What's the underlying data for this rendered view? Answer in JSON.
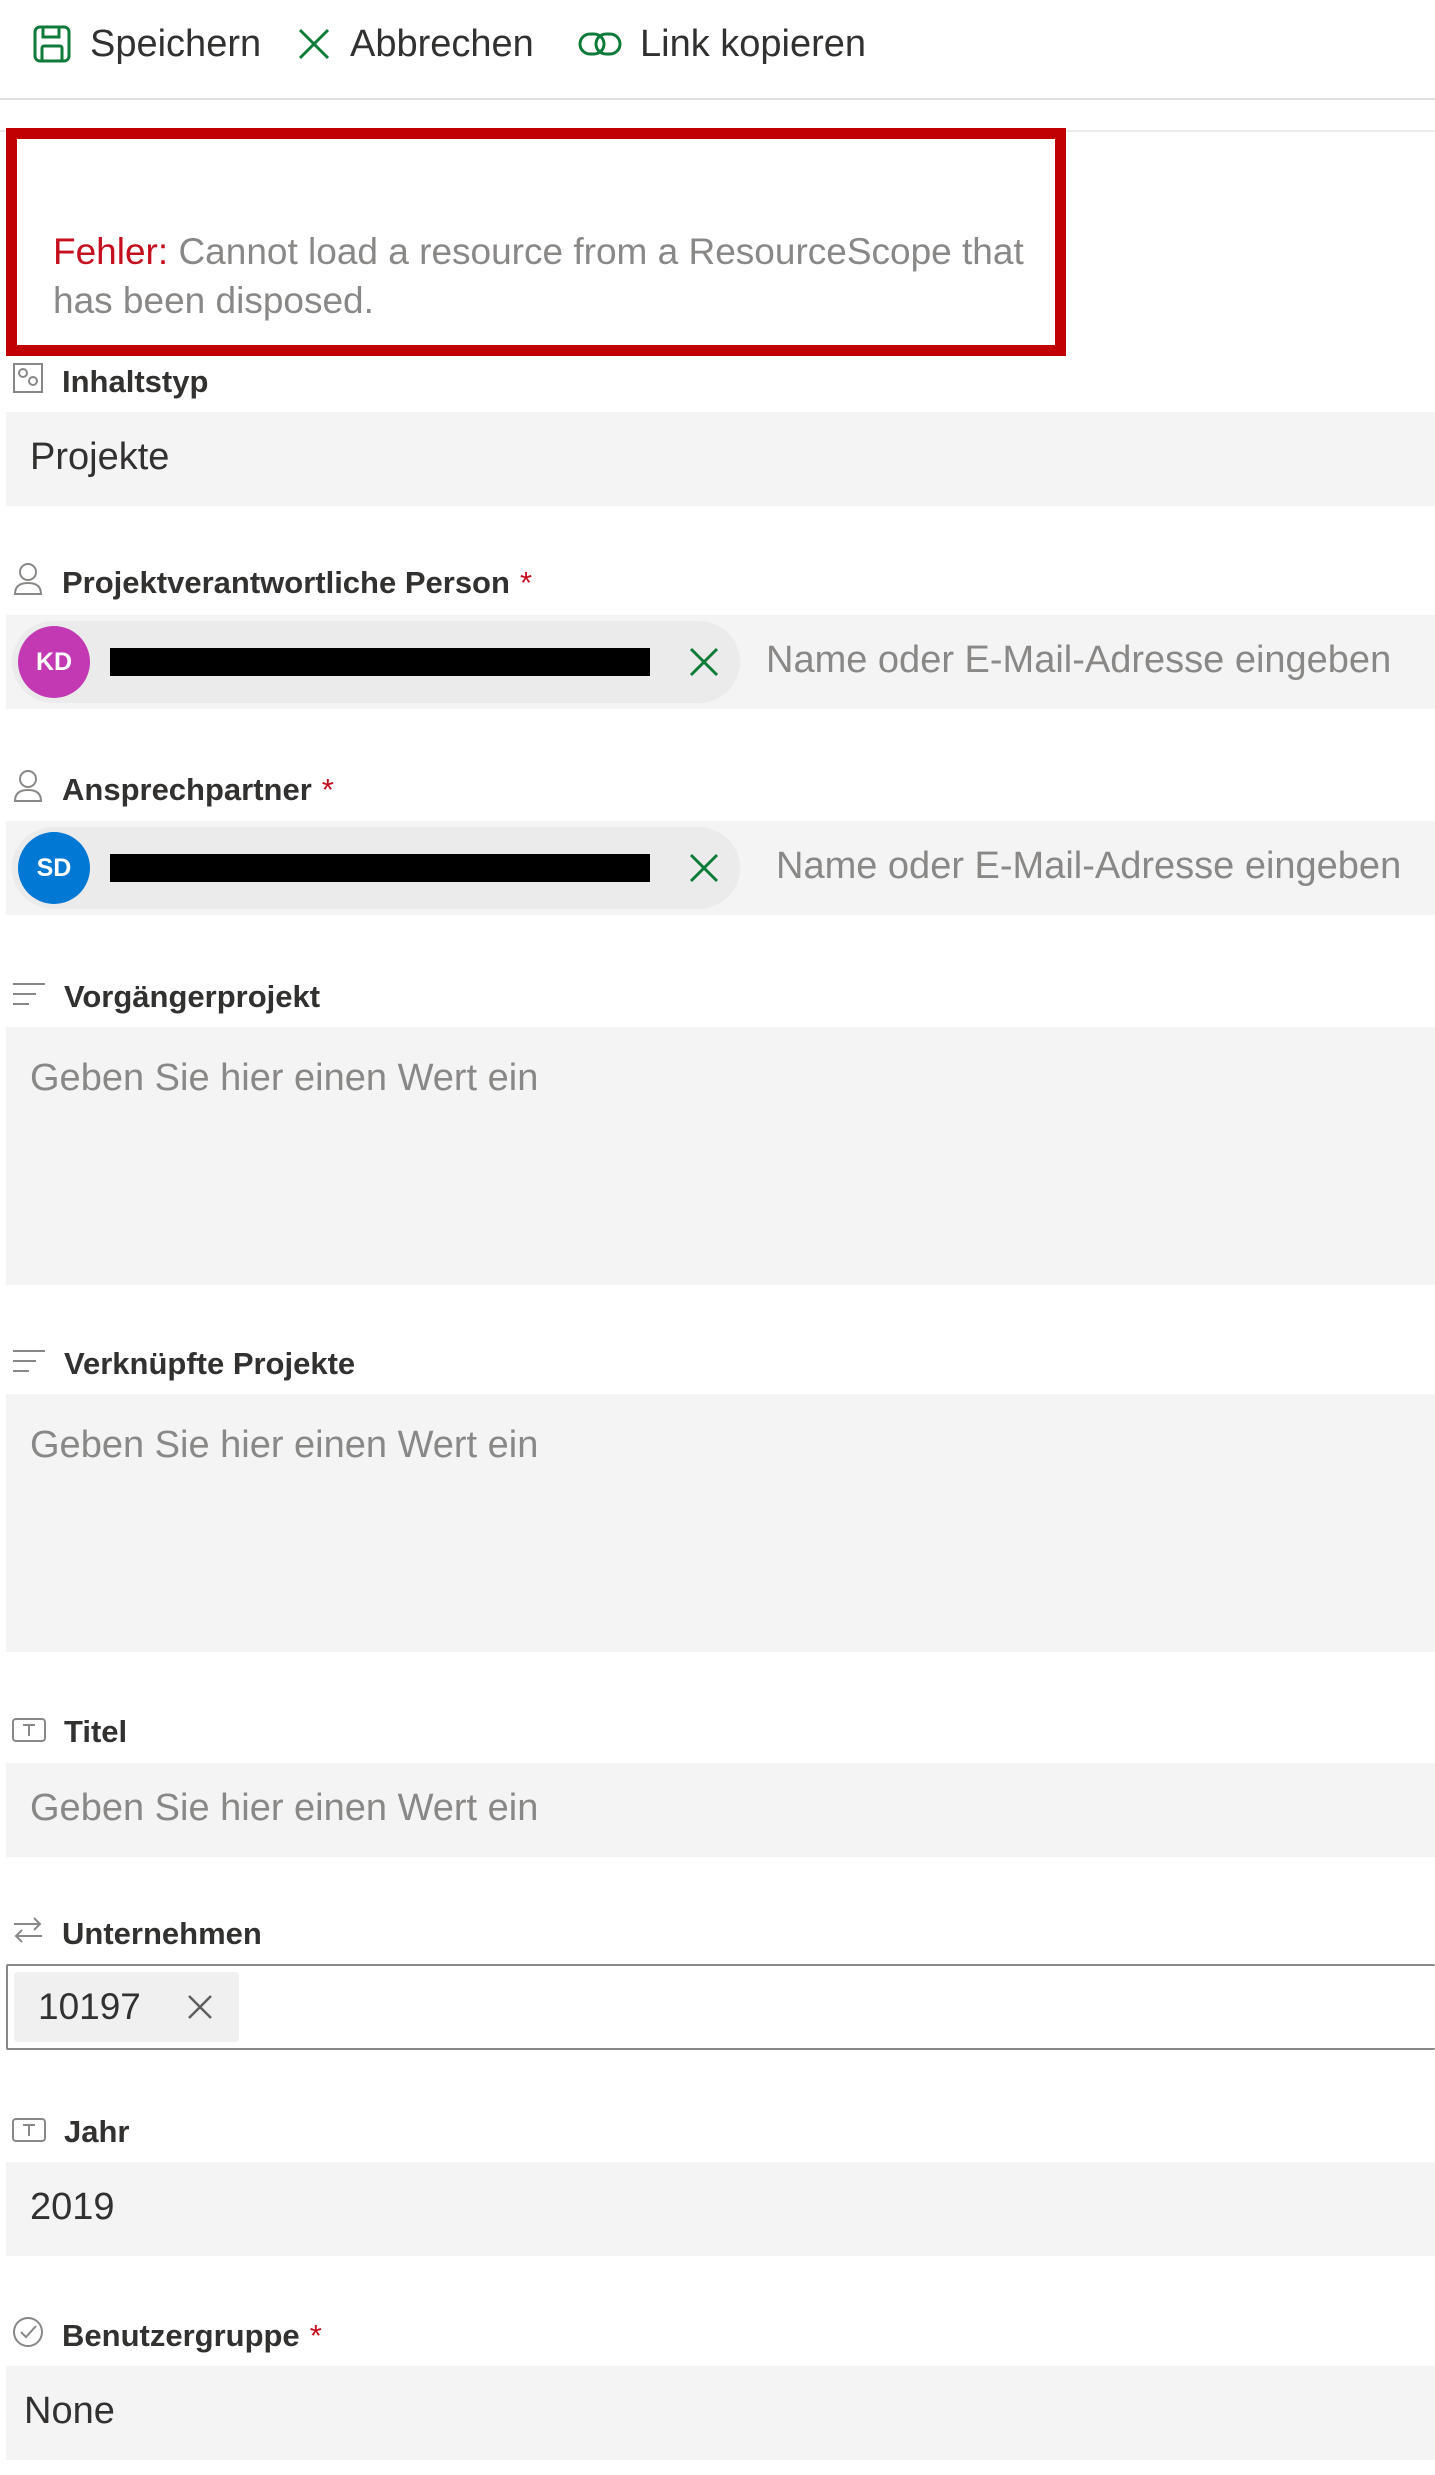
{
  "toolbar": {
    "save_label": "Speichern",
    "cancel_label": "Abbrechen",
    "copy_link_label": "Link kopieren"
  },
  "error": {
    "prefix": "Fehler:",
    "message": "Cannot load a resource from a ResourceScope that has been disposed."
  },
  "fields": {
    "content_type": {
      "label": "Inhaltstyp",
      "value": "Projekte"
    },
    "project_owner": {
      "label": "Projektverantwortliche Person",
      "required_mark": "*",
      "persona_initials": "KD",
      "placeholder": "Name oder E-Mail-Adresse eingeben"
    },
    "contact": {
      "label": "Ansprechpartner",
      "required_mark": "*",
      "persona_initials": "SD",
      "placeholder": "Name oder E-Mail-Adresse eingeben"
    },
    "predecessor_project": {
      "label": "Vorgängerprojekt",
      "placeholder": "Geben Sie hier einen Wert ein"
    },
    "linked_projects": {
      "label": "Verknüpfte Projekte",
      "placeholder": "Geben Sie hier einen Wert ein"
    },
    "title": {
      "label": "Titel",
      "placeholder": "Geben Sie hier einen Wert ein"
    },
    "company": {
      "label": "Unternehmen",
      "tag_value": "10197"
    },
    "year": {
      "label": "Jahr",
      "value": "2019"
    },
    "user_group": {
      "label": "Benutzergruppe",
      "required_mark": "*",
      "value": "None"
    }
  },
  "colors": {
    "save_icon": "#0f7b3b",
    "cancel_icon": "#0f7b3b",
    "link_icon": "#0f7b3b",
    "error_border": "#c00000",
    "error_label": "#c50f1f",
    "required": "#c50f1f",
    "avatar_kd": "#c239b3",
    "avatar_sd": "#0078d4"
  },
  "icons": {
    "save": "save-icon",
    "cancel": "close-icon",
    "link": "link-icon",
    "content_type": "content-type-icon",
    "person": "person-icon",
    "multiline": "multiline-text-icon",
    "text": "text-field-icon",
    "lookup": "lookup-icon",
    "choice": "choice-icon"
  }
}
